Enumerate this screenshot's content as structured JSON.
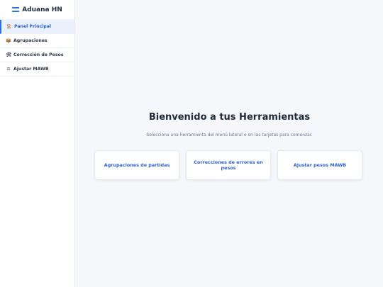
{
  "brand": {
    "title": "Aduana HN"
  },
  "sidebar": {
    "items": [
      {
        "icon": "🏠",
        "label": "Panel Principal",
        "active": true
      },
      {
        "icon": "📦",
        "label": "Agrupaciones"
      },
      {
        "icon": "🛠",
        "label": "Corrección de Pesos"
      },
      {
        "icon": "⚖",
        "label": "Ajustar MAWB"
      }
    ]
  },
  "main": {
    "title": "Bienvenido a tus Herramientas",
    "subtitle": "Selecciona una herramienta del menú lateral o en las tarjetas para comenzar.",
    "cards": [
      {
        "label": "Agrupaciones de partidas"
      },
      {
        "label": "Correcciones de errores en pesos"
      },
      {
        "label": "Ajustar pesos MAWB"
      }
    ]
  },
  "colors": {
    "accent": "#2b5fcf",
    "active_bg": "#eaf1fd",
    "page_bg": "#f5f7fa"
  }
}
